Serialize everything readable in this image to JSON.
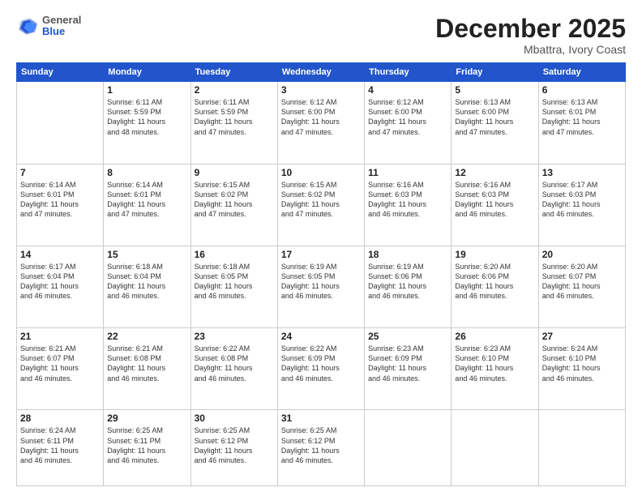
{
  "header": {
    "logo_general": "General",
    "logo_blue": "Blue",
    "month_title": "December 2025",
    "location": "Mbattra, Ivory Coast"
  },
  "weekdays": [
    "Sunday",
    "Monday",
    "Tuesday",
    "Wednesday",
    "Thursday",
    "Friday",
    "Saturday"
  ],
  "weeks": [
    [
      {
        "day": "",
        "info": ""
      },
      {
        "day": "1",
        "info": "Sunrise: 6:11 AM\nSunset: 5:59 PM\nDaylight: 11 hours\nand 48 minutes."
      },
      {
        "day": "2",
        "info": "Sunrise: 6:11 AM\nSunset: 5:59 PM\nDaylight: 11 hours\nand 47 minutes."
      },
      {
        "day": "3",
        "info": "Sunrise: 6:12 AM\nSunset: 6:00 PM\nDaylight: 11 hours\nand 47 minutes."
      },
      {
        "day": "4",
        "info": "Sunrise: 6:12 AM\nSunset: 6:00 PM\nDaylight: 11 hours\nand 47 minutes."
      },
      {
        "day": "5",
        "info": "Sunrise: 6:13 AM\nSunset: 6:00 PM\nDaylight: 11 hours\nand 47 minutes."
      },
      {
        "day": "6",
        "info": "Sunrise: 6:13 AM\nSunset: 6:01 PM\nDaylight: 11 hours\nand 47 minutes."
      }
    ],
    [
      {
        "day": "7",
        "info": "Sunrise: 6:14 AM\nSunset: 6:01 PM\nDaylight: 11 hours\nand 47 minutes."
      },
      {
        "day": "8",
        "info": "Sunrise: 6:14 AM\nSunset: 6:01 PM\nDaylight: 11 hours\nand 47 minutes."
      },
      {
        "day": "9",
        "info": "Sunrise: 6:15 AM\nSunset: 6:02 PM\nDaylight: 11 hours\nand 47 minutes."
      },
      {
        "day": "10",
        "info": "Sunrise: 6:15 AM\nSunset: 6:02 PM\nDaylight: 11 hours\nand 47 minutes."
      },
      {
        "day": "11",
        "info": "Sunrise: 6:16 AM\nSunset: 6:03 PM\nDaylight: 11 hours\nand 46 minutes."
      },
      {
        "day": "12",
        "info": "Sunrise: 6:16 AM\nSunset: 6:03 PM\nDaylight: 11 hours\nand 46 minutes."
      },
      {
        "day": "13",
        "info": "Sunrise: 6:17 AM\nSunset: 6:03 PM\nDaylight: 11 hours\nand 46 minutes."
      }
    ],
    [
      {
        "day": "14",
        "info": "Sunrise: 6:17 AM\nSunset: 6:04 PM\nDaylight: 11 hours\nand 46 minutes."
      },
      {
        "day": "15",
        "info": "Sunrise: 6:18 AM\nSunset: 6:04 PM\nDaylight: 11 hours\nand 46 minutes."
      },
      {
        "day": "16",
        "info": "Sunrise: 6:18 AM\nSunset: 6:05 PM\nDaylight: 11 hours\nand 46 minutes."
      },
      {
        "day": "17",
        "info": "Sunrise: 6:19 AM\nSunset: 6:05 PM\nDaylight: 11 hours\nand 46 minutes."
      },
      {
        "day": "18",
        "info": "Sunrise: 6:19 AM\nSunset: 6:06 PM\nDaylight: 11 hours\nand 46 minutes."
      },
      {
        "day": "19",
        "info": "Sunrise: 6:20 AM\nSunset: 6:06 PM\nDaylight: 11 hours\nand 46 minutes."
      },
      {
        "day": "20",
        "info": "Sunrise: 6:20 AM\nSunset: 6:07 PM\nDaylight: 11 hours\nand 46 minutes."
      }
    ],
    [
      {
        "day": "21",
        "info": "Sunrise: 6:21 AM\nSunset: 6:07 PM\nDaylight: 11 hours\nand 46 minutes."
      },
      {
        "day": "22",
        "info": "Sunrise: 6:21 AM\nSunset: 6:08 PM\nDaylight: 11 hours\nand 46 minutes."
      },
      {
        "day": "23",
        "info": "Sunrise: 6:22 AM\nSunset: 6:08 PM\nDaylight: 11 hours\nand 46 minutes."
      },
      {
        "day": "24",
        "info": "Sunrise: 6:22 AM\nSunset: 6:09 PM\nDaylight: 11 hours\nand 46 minutes."
      },
      {
        "day": "25",
        "info": "Sunrise: 6:23 AM\nSunset: 6:09 PM\nDaylight: 11 hours\nand 46 minutes."
      },
      {
        "day": "26",
        "info": "Sunrise: 6:23 AM\nSunset: 6:10 PM\nDaylight: 11 hours\nand 46 minutes."
      },
      {
        "day": "27",
        "info": "Sunrise: 6:24 AM\nSunset: 6:10 PM\nDaylight: 11 hours\nand 46 minutes."
      }
    ],
    [
      {
        "day": "28",
        "info": "Sunrise: 6:24 AM\nSunset: 6:11 PM\nDaylight: 11 hours\nand 46 minutes."
      },
      {
        "day": "29",
        "info": "Sunrise: 6:25 AM\nSunset: 6:11 PM\nDaylight: 11 hours\nand 46 minutes."
      },
      {
        "day": "30",
        "info": "Sunrise: 6:25 AM\nSunset: 6:12 PM\nDaylight: 11 hours\nand 46 minutes."
      },
      {
        "day": "31",
        "info": "Sunrise: 6:25 AM\nSunset: 6:12 PM\nDaylight: 11 hours\nand 46 minutes."
      },
      {
        "day": "",
        "info": ""
      },
      {
        "day": "",
        "info": ""
      },
      {
        "day": "",
        "info": ""
      }
    ]
  ]
}
